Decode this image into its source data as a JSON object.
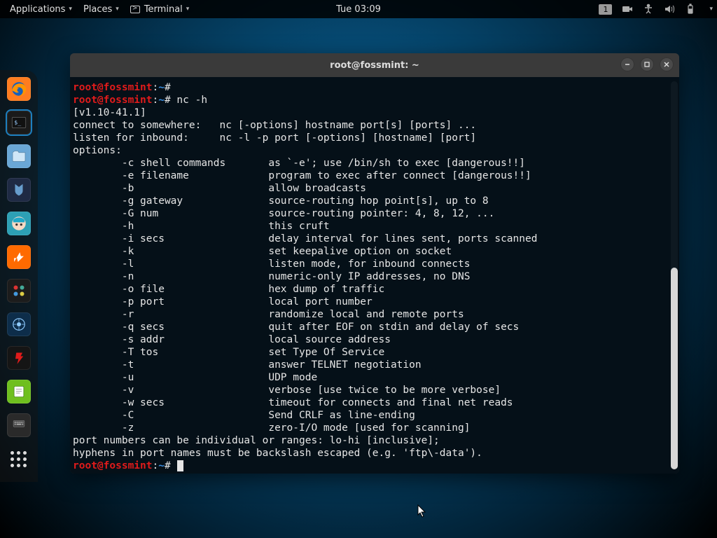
{
  "panel": {
    "applications": "Applications",
    "places": "Places",
    "terminal": "Terminal",
    "clock": "Tue 03:09",
    "workspace": "1"
  },
  "dock": {
    "items": [
      {
        "name": "firefox",
        "bg": "#ff7c1f",
        "glyph": "",
        "active": false
      },
      {
        "name": "terminal",
        "bg": "#1a1a1a",
        "glyph": "",
        "active": true
      },
      {
        "name": "files",
        "bg": "#3c6ea5",
        "glyph": "",
        "active": false
      },
      {
        "name": "metasploit",
        "bg": "#1f2a44",
        "glyph": "",
        "active": false
      },
      {
        "name": "colorpick",
        "bg": "#2f6f7e",
        "glyph": "",
        "active": false
      },
      {
        "name": "burpsuite",
        "bg": "#ff6a00",
        "glyph": "",
        "active": false
      },
      {
        "name": "maltego",
        "bg": "#1c1c1c",
        "glyph": "",
        "active": false
      },
      {
        "name": "zenmap",
        "bg": "#0d2d4a",
        "glyph": "",
        "active": false
      },
      {
        "name": "faraday",
        "bg": "#e0121c",
        "glyph": "",
        "active": false
      },
      {
        "name": "notes",
        "bg": "#6fbf1f",
        "glyph": "",
        "active": false
      },
      {
        "name": "keyboard",
        "bg": "#2a2a2a",
        "glyph": "",
        "active": false
      }
    ]
  },
  "window": {
    "title": "root@fossmint: ~",
    "prompt": {
      "user": "root",
      "host": "fossmint",
      "path": "~",
      "symbol": "#"
    },
    "command": "nc -h",
    "scroll_thumb_top_pct": 48,
    "scroll_thumb_height_pct": 52,
    "lines": [
      "[v1.10-41.1]",
      "connect to somewhere:   nc [-options] hostname port[s] [ports] ...",
      "listen for inbound:     nc -l -p port [-options] [hostname] [port]",
      "options:",
      "        -c shell commands       as `-e'; use /bin/sh to exec [dangerous!!]",
      "        -e filename             program to exec after connect [dangerous!!]",
      "        -b                      allow broadcasts",
      "        -g gateway              source-routing hop point[s], up to 8",
      "        -G num                  source-routing pointer: 4, 8, 12, ...",
      "        -h                      this cruft",
      "        -i secs                 delay interval for lines sent, ports scanned",
      "        -k                      set keepalive option on socket",
      "        -l                      listen mode, for inbound connects",
      "        -n                      numeric-only IP addresses, no DNS",
      "        -o file                 hex dump of traffic",
      "        -p port                 local port number",
      "        -r                      randomize local and remote ports",
      "        -q secs                 quit after EOF on stdin and delay of secs",
      "        -s addr                 local source address",
      "        -T tos                  set Type Of Service",
      "        -t                      answer TELNET negotiation",
      "        -u                      UDP mode",
      "        -v                      verbose [use twice to be more verbose]",
      "        -w secs                 timeout for connects and final net reads",
      "        -C                      Send CRLF as line-ending",
      "        -z                      zero-I/O mode [used for scanning]",
      "port numbers can be individual or ranges: lo-hi [inclusive];",
      "hyphens in port names must be backslash escaped (e.g. 'ftp\\-data')."
    ]
  }
}
